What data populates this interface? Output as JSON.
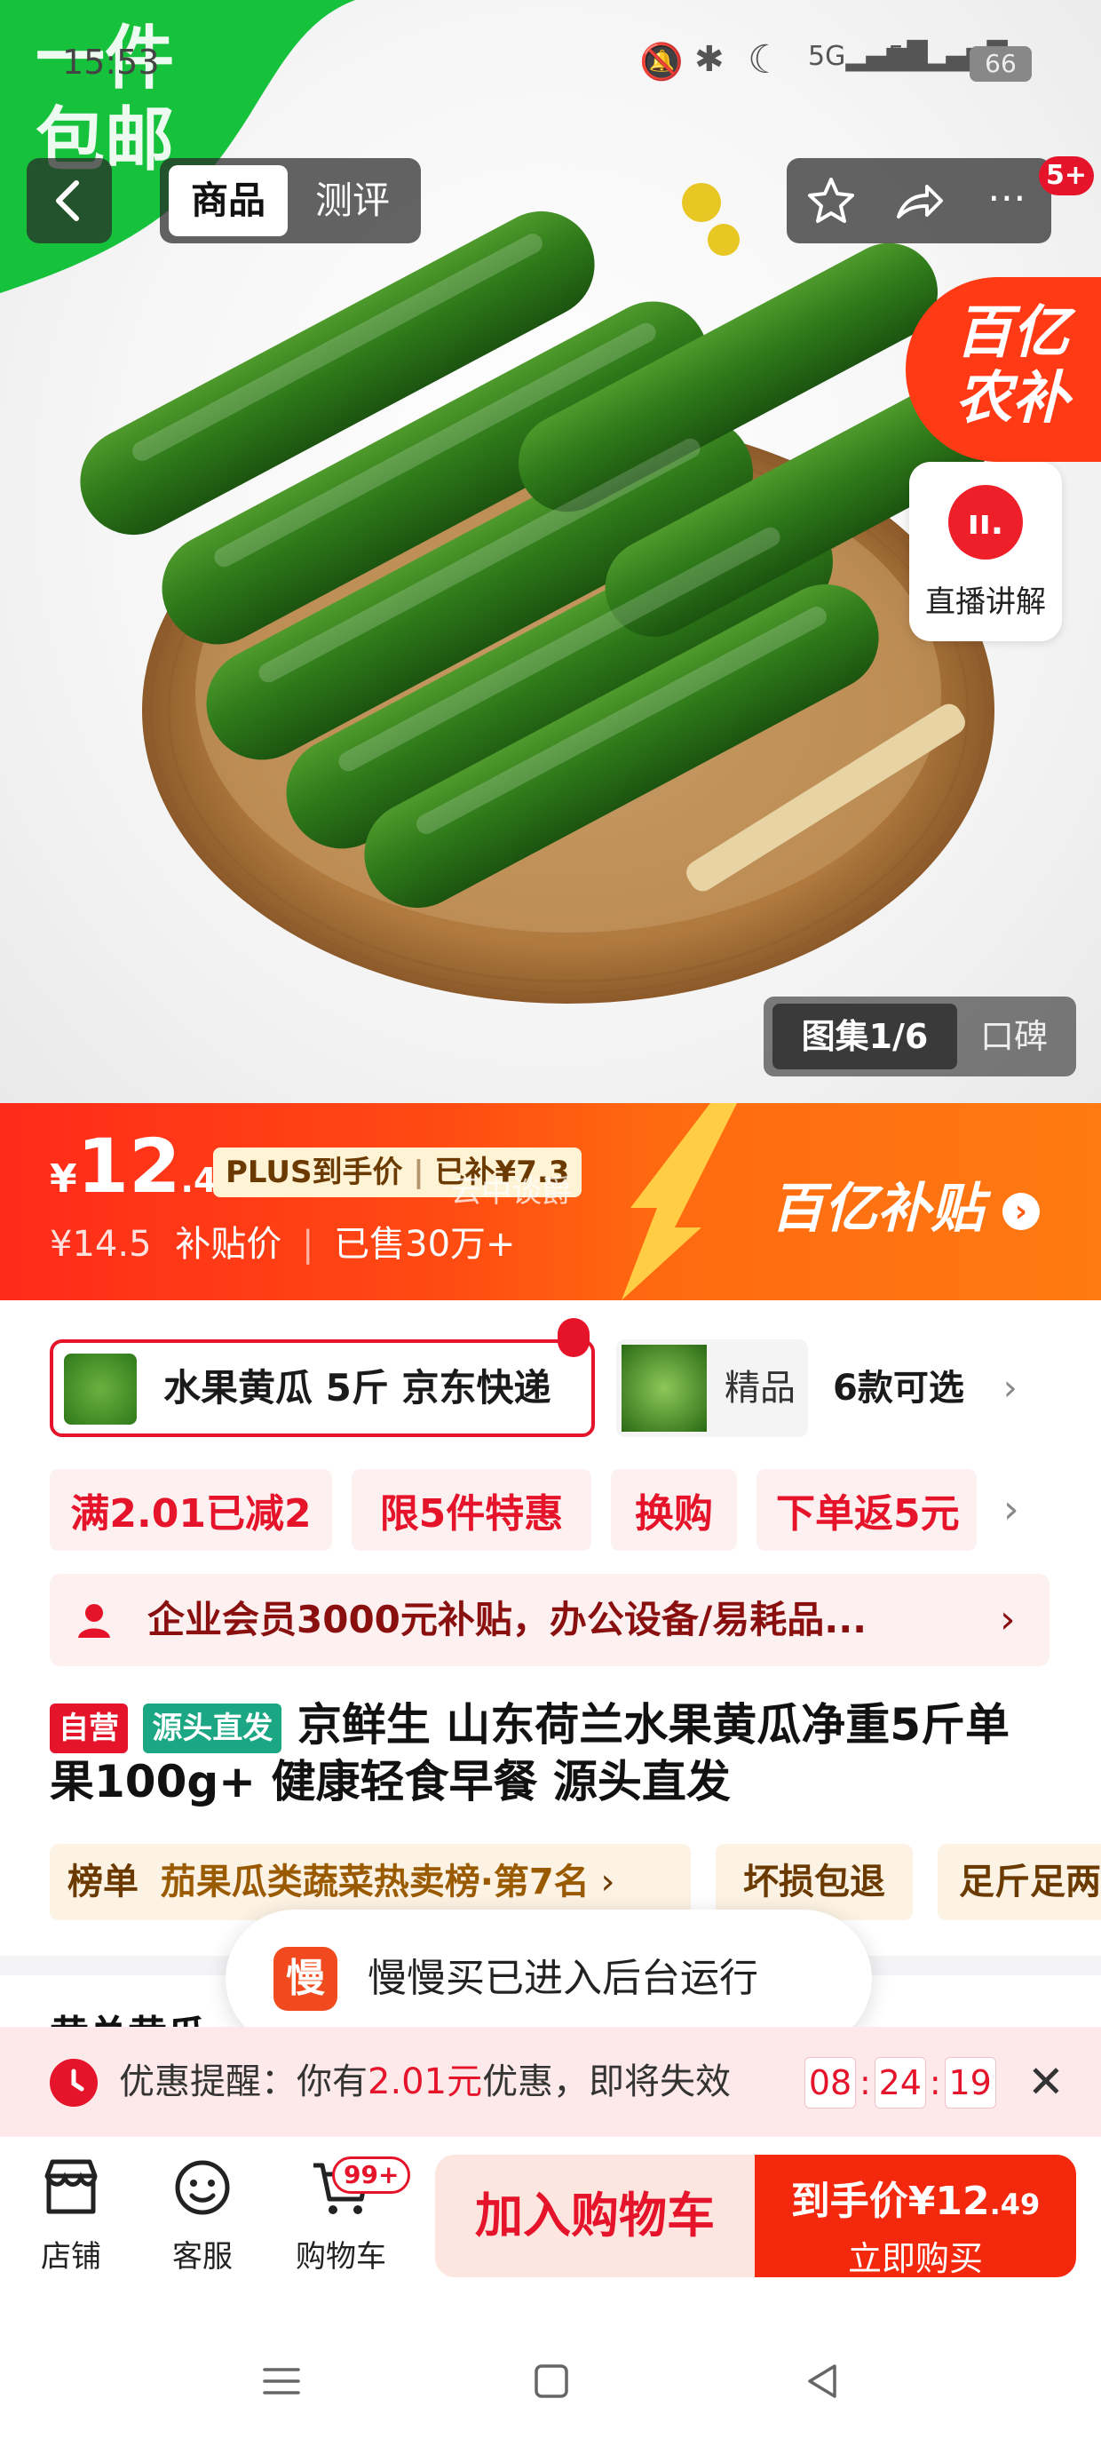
{
  "status_bar": {
    "time": "15:53",
    "battery": "66"
  },
  "promo_banner": {
    "line1": "一件",
    "line2": "包邮"
  },
  "top_tabs": [
    {
      "label": "商品",
      "active": true
    },
    {
      "label": "测评",
      "active": false
    }
  ],
  "cart_badge_top": "5+",
  "subsidy_badge": {
    "line1": "百亿",
    "line2": "农补"
  },
  "live": {
    "label": "直播讲解"
  },
  "gallery": {
    "label": "图集1/6",
    "alt_label": "口碑"
  },
  "price": {
    "currency": "¥",
    "integer": "12",
    "decimal": ".49",
    "plus_label": "PLUS到手价",
    "subsidy_amount": "已补¥7.3",
    "original": "¥14.5",
    "subsidy_price_label": "补贴价",
    "sold": "已售30万+",
    "watermark": "云中谈爵",
    "brand_subsidy": "百亿补贴"
  },
  "variants": {
    "selected": "水果黄瓜 5斤 京东快递",
    "other": "精品",
    "count": "6款可选"
  },
  "promos": [
    "满2.01已减2",
    "限5件特惠",
    "换购",
    "下单返5元"
  ],
  "enterprise": {
    "text": "企业会员3000元补贴，办公设备/易耗品..."
  },
  "title": {
    "tag_self": "自营",
    "tag_source": "源头直发",
    "text": "京鲜生 山东荷兰水果黄瓜净重5斤单果100g+ 健康轻食早餐 源头直发"
  },
  "ranks": [
    {
      "prefix": "榜单",
      "text": "茄果瓜类蔬菜热卖榜·第7名"
    },
    {
      "text": "坏损包退"
    },
    {
      "text": "足斤足两"
    }
  ],
  "partial_heading": "黄总黄瓜",
  "toast": {
    "app_name": "慢慢买",
    "text": "慢慢买已进入后台运行"
  },
  "reminder": {
    "prefix": "优惠提醒：你有",
    "amount": "2.01元",
    "suffix": "优惠，即将失效",
    "timer": [
      "08",
      "24",
      "19"
    ]
  },
  "bottom_bar": {
    "shop": "店铺",
    "service": "客服",
    "cart": "购物车",
    "cart_badge": "99+",
    "add_cart": "加入购物车",
    "buy_price_label": "到手价",
    "buy_price": "¥12",
    "buy_price_decimal": ".49",
    "buy_now": "立即购买"
  },
  "colors": {
    "accent_red": "#e5142a",
    "orange": "#ff6a10",
    "green": "#23c343"
  }
}
